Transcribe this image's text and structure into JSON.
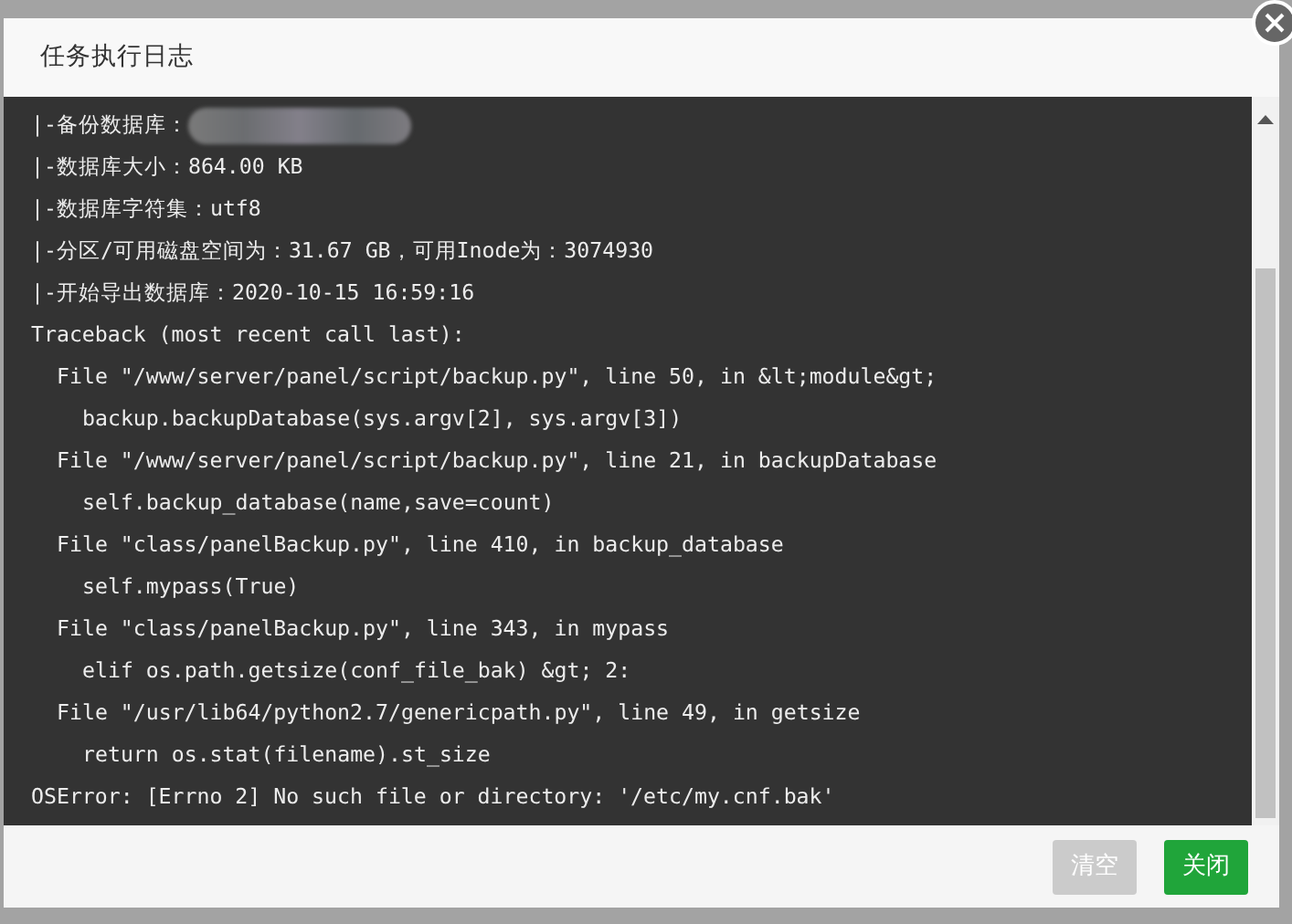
{
  "dialog": {
    "title": "任务执行日志"
  },
  "log": [
    {
      "kind": "info",
      "text": "|-备份数据库：",
      "redacted": true
    },
    {
      "kind": "info",
      "text": "|-数据库大小：864.00 KB"
    },
    {
      "kind": "info",
      "text": "|-数据库字符集：utf8"
    },
    {
      "kind": "info",
      "text": "|-分区/可用磁盘空间为：31.67 GB，可用Inode为：3074930"
    },
    {
      "kind": "info",
      "text": "|-开始导出数据库：2020-10-15 16:59:16"
    },
    {
      "kind": "info",
      "text": "Traceback (most recent call last):"
    },
    {
      "kind": "frame",
      "text": "File \"/www/server/panel/script/backup.py\", line 50, in &lt;module&gt;"
    },
    {
      "kind": "code",
      "text": "backup.backupDatabase(sys.argv[2], sys.argv[3])"
    },
    {
      "kind": "frame",
      "text": "File \"/www/server/panel/script/backup.py\", line 21, in backupDatabase"
    },
    {
      "kind": "code",
      "text": "self.backup_database(name,save=count)"
    },
    {
      "kind": "frame",
      "text": "File \"class/panelBackup.py\", line 410, in backup_database"
    },
    {
      "kind": "code",
      "text": "self.mypass(True)"
    },
    {
      "kind": "frame",
      "text": "File \"class/panelBackup.py\", line 343, in mypass"
    },
    {
      "kind": "code",
      "text": "elif os.path.getsize(conf_file_bak) &gt; 2:"
    },
    {
      "kind": "frame",
      "text": "File \"/usr/lib64/python2.7/genericpath.py\", line 49, in getsize"
    },
    {
      "kind": "code",
      "text": "return os.stat(filename).st_size"
    },
    {
      "kind": "info",
      "text": "OSError: [Errno 2] No such file or directory: '/etc/my.cnf.bak'"
    }
  ],
  "buttons": [
    {
      "label": "清空",
      "disabled": true
    },
    {
      "label": "关闭",
      "disabled": false
    }
  ]
}
